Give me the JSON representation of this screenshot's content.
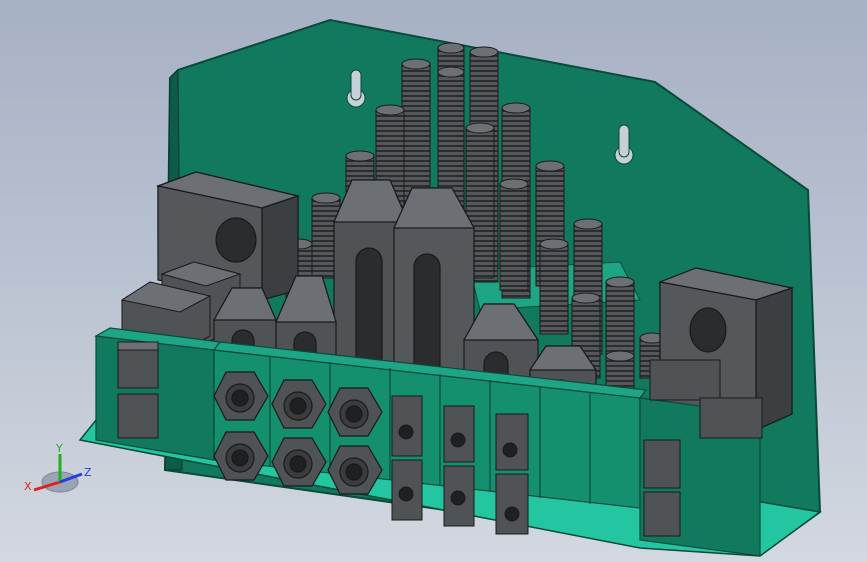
{
  "viewport": {
    "background_top": "#a7b1c4",
    "background_bottom": "#d3d8e0"
  },
  "model": {
    "plate_color": "#117a5e",
    "plate_edge": "#0a4a38",
    "base_color": "#23c6a0",
    "part_color": "#505356",
    "part_light": "#6c7074",
    "part_dark": "#2e3032",
    "edge_color": "#1a1a1a"
  },
  "triad": {
    "x_label": "X",
    "y_label": "Y",
    "z_label": "Z",
    "x_color": "#e02020",
    "y_color": "#20b020",
    "z_color": "#2040e0"
  }
}
